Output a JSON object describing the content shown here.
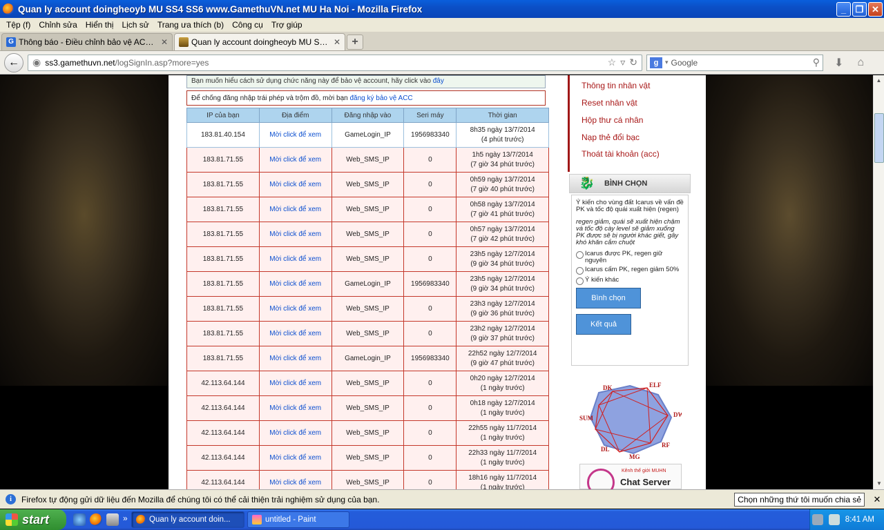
{
  "window": {
    "title": "Quan ly account doingheoyb MU SS4 SS6 www.GamethuVN.net MU Ha Noi - Mozilla Firefox",
    "minimize": "_",
    "maximize": "❐",
    "close": "✕"
  },
  "menubar": [
    "Tệp (f)",
    "Chỉnh sửa",
    "Hiển thị",
    "Lịch sử",
    "Trang ưa thích (b)",
    "Công cụ",
    "Trợ giúp"
  ],
  "tabs": [
    {
      "label": "Thông báo - Điều chỉnh bảo vệ ACC (Báo...",
      "active": false
    },
    {
      "label": "Quan ly account doingheoyb MU SS4 SS6...",
      "active": true
    }
  ],
  "newtab": "+",
  "navbar": {
    "url_host": "ss3.gamethuvn.net",
    "url_path": "/logSignIn.asp?more=yes",
    "search_placeholder": "Google"
  },
  "page": {
    "notice1_text": "Bạn muốn hiểu cách sử dụng chức năng này để bảo vệ account, hãy click vào ",
    "notice1_link": "đây",
    "notice2_text": "Để chống đăng nhập trái phép và trộm đồ, mời bạn ",
    "notice2_link": "đăng ký bảo vệ ACC",
    "table": {
      "headers": [
        "IP của bạn",
        "Địa điểm",
        "Đăng nhập vào",
        "Seri máy",
        "Thời gian"
      ],
      "rows": [
        {
          "ip": "183.81.40.154",
          "loc": "Mời click để xem",
          "via": "GameLogin_IP",
          "seri": "1956983340",
          "time": "8h35 ngày 13/7/2014",
          "ago": "(4 phút trước)"
        },
        {
          "ip": "183.81.71.55",
          "loc": "Mời click để xem",
          "via": "Web_SMS_IP",
          "seri": "0",
          "time": "1h5 ngày 13/7/2014",
          "ago": "(7 giờ 34 phút trước)"
        },
        {
          "ip": "183.81.71.55",
          "loc": "Mời click để xem",
          "via": "Web_SMS_IP",
          "seri": "0",
          "time": "0h59 ngày 13/7/2014",
          "ago": "(7 giờ 40 phút trước)"
        },
        {
          "ip": "183.81.71.55",
          "loc": "Mời click để xem",
          "via": "Web_SMS_IP",
          "seri": "0",
          "time": "0h58 ngày 13/7/2014",
          "ago": "(7 giờ 41 phút trước)"
        },
        {
          "ip": "183.81.71.55",
          "loc": "Mời click để xem",
          "via": "Web_SMS_IP",
          "seri": "0",
          "time": "0h57 ngày 13/7/2014",
          "ago": "(7 giờ 42 phút trước)"
        },
        {
          "ip": "183.81.71.55",
          "loc": "Mời click để xem",
          "via": "Web_SMS_IP",
          "seri": "0",
          "time": "23h5 ngày 12/7/2014",
          "ago": "(9 giờ 34 phút trước)"
        },
        {
          "ip": "183.81.71.55",
          "loc": "Mời click để xem",
          "via": "GameLogin_IP",
          "seri": "1956983340",
          "time": "23h5 ngày 12/7/2014",
          "ago": "(9 giờ 34 phút trước)"
        },
        {
          "ip": "183.81.71.55",
          "loc": "Mời click để xem",
          "via": "Web_SMS_IP",
          "seri": "0",
          "time": "23h3 ngày 12/7/2014",
          "ago": "(9 giờ 36 phút trước)"
        },
        {
          "ip": "183.81.71.55",
          "loc": "Mời click để xem",
          "via": "Web_SMS_IP",
          "seri": "0",
          "time": "23h2 ngày 12/7/2014",
          "ago": "(9 giờ 37 phút trước)"
        },
        {
          "ip": "183.81.71.55",
          "loc": "Mời click để xem",
          "via": "GameLogin_IP",
          "seri": "1956983340",
          "time": "22h52 ngày 12/7/2014",
          "ago": "(9 giờ 47 phút trước)"
        },
        {
          "ip": "42.113.64.144",
          "loc": "Mời click để xem",
          "via": "Web_SMS_IP",
          "seri": "0",
          "time": "0h20 ngày 12/7/2014",
          "ago": "(1 ngày trước)"
        },
        {
          "ip": "42.113.64.144",
          "loc": "Mời click để xem",
          "via": "Web_SMS_IP",
          "seri": "0",
          "time": "0h18 ngày 12/7/2014",
          "ago": "(1 ngày trước)"
        },
        {
          "ip": "42.113.64.144",
          "loc": "Mời click để xem",
          "via": "Web_SMS_IP",
          "seri": "0",
          "time": "22h55 ngày 11/7/2014",
          "ago": "(1 ngày trước)"
        },
        {
          "ip": "42.113.64.144",
          "loc": "Mời click để xem",
          "via": "Web_SMS_IP",
          "seri": "0",
          "time": "22h33 ngày 11/7/2014",
          "ago": "(1 ngày trước)"
        },
        {
          "ip": "42.113.64.144",
          "loc": "Mời click để xem",
          "via": "Web_SMS_IP",
          "seri": "0",
          "time": "18h16 ngày 11/7/2014",
          "ago": "(1 ngày trước)"
        }
      ]
    }
  },
  "sidebar": {
    "menu": [
      "Thông tin nhân vật",
      "Reset nhân vật",
      "Hộp thư cá nhân",
      "Nạp thẻ đổi bạc",
      "Thoát tài khoản (acc)"
    ],
    "vote": {
      "title": "BÌNH CHỌN",
      "question": "Ý kiến cho vùng đất Icarus về vấn đề PK và tốc độ quái xuất hiện (regen)",
      "desc": "regen giảm, quái sẽ xuất hiện chậm và tốc độ cày level sẽ giảm xuống PK được sẽ bị người khác giết, gây khó khăn cắm chuột",
      "options": [
        "Icarus được PK, regen giữ nguyên",
        "Icarus cấm PK, regen giảm 50%",
        "Ý kiến khác"
      ],
      "vote_button": "Bình chọn",
      "result_button": "Kết quả"
    },
    "classes": [
      "DK",
      "ELF",
      "DW",
      "RF",
      "MG",
      "DL",
      "SUM"
    ],
    "chat": {
      "subtitle": "Kênh thế giới MUHN",
      "title": "Chat Server"
    }
  },
  "notification": {
    "message": "Firefox tự động gửi dữ liệu đến Mozilla để chúng tôi có thể cải thiện trải nghiệm sử dụng của bạn.",
    "button": "Chọn những thứ tôi muốn chia sẻ",
    "close": "✕"
  },
  "taskbar": {
    "start": "start",
    "tasks": [
      {
        "label": "Quan ly account doin...",
        "active": true
      },
      {
        "label": "untitled - Paint",
        "active": false
      }
    ],
    "quick_more": "»",
    "clock": "8:41 AM"
  },
  "colors": {
    "accent_red": "#a81818",
    "link_blue": "#0b4fd0",
    "table_header": "#aed4ee"
  }
}
